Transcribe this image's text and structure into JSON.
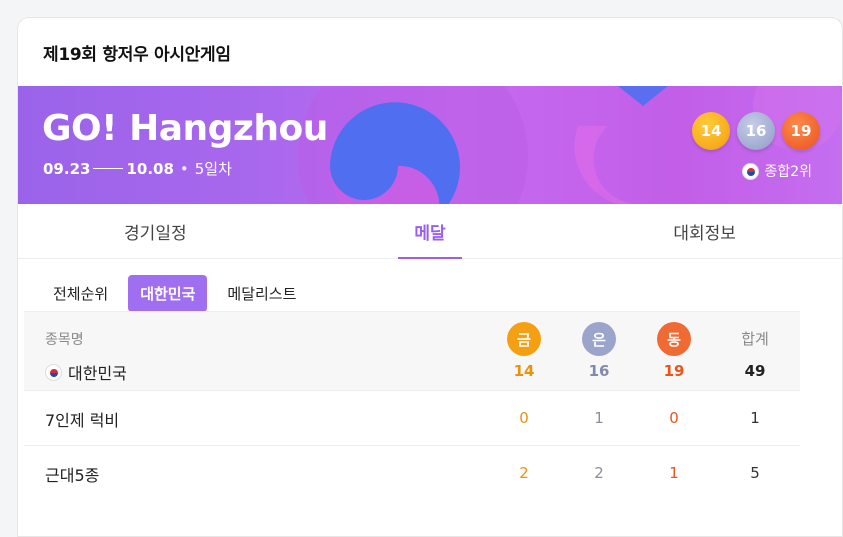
{
  "card": {
    "title": "제19회 항저우 아시안게임"
  },
  "banner": {
    "logo": "GO! Hangzhou",
    "date_start": "09.23",
    "date_end": "10.08",
    "day_label": "5일차",
    "medals": {
      "gold": "14",
      "silver": "16",
      "bronze": "19"
    },
    "rank_label": "종합2위",
    "colors": {
      "gold": "#f49c0c",
      "silver": "#8f9bc7",
      "bronze": "#e8521b",
      "bg": "#b066ee"
    }
  },
  "tabs": [
    {
      "label": "경기일정"
    },
    {
      "label": "메달"
    },
    {
      "label": "대회정보"
    }
  ],
  "subtabs": [
    {
      "label": "전체순위"
    },
    {
      "label": "대한민국"
    },
    {
      "label": "메달리스트"
    }
  ],
  "table": {
    "header_label": "종목명",
    "country": "대한민국",
    "medal_headers": {
      "gold": "금",
      "silver": "은",
      "bronze": "동",
      "total": "합계"
    },
    "totals": {
      "gold": "14",
      "silver": "16",
      "bronze": "19",
      "total": "49"
    },
    "rows": [
      {
        "name": "7인제 럭비",
        "gold": "0",
        "silver": "1",
        "bronze": "0",
        "total": "1"
      },
      {
        "name": "근대5종",
        "gold": "2",
        "silver": "2",
        "bronze": "1",
        "total": "5"
      }
    ]
  }
}
